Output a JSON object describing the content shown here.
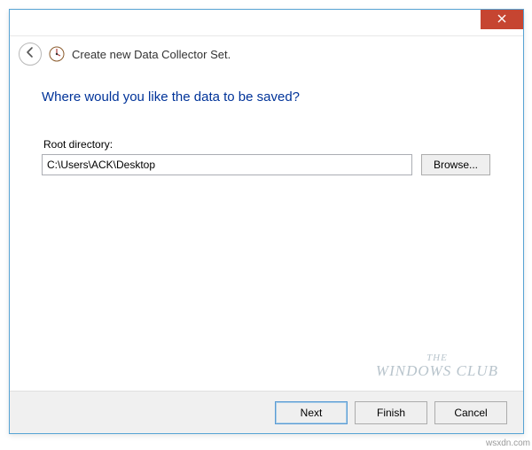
{
  "header": {
    "wizard_title": "Create new Data Collector Set."
  },
  "page": {
    "heading": "Where would you like the data to be saved?",
    "root_dir_label": "Root directory:",
    "root_dir_value": "C:\\Users\\ACK\\Desktop",
    "browse_label": "Browse..."
  },
  "footer": {
    "next_label": "Next",
    "finish_label": "Finish",
    "cancel_label": "Cancel"
  },
  "watermark": {
    "line1": "THE",
    "line2": "WINDOWS CLUB"
  },
  "attribution": "wsxdn.com"
}
